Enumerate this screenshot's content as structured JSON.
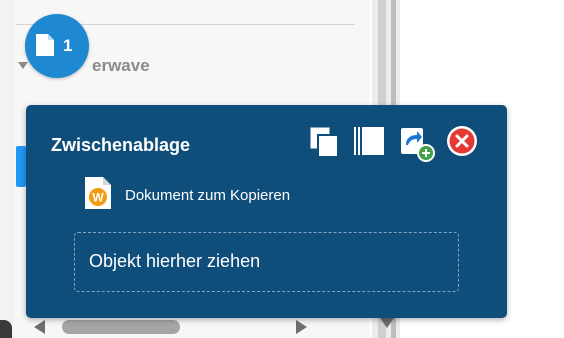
{
  "badge": {
    "count": "1",
    "icon": "document-icon"
  },
  "tree": {
    "label": "erwave"
  },
  "clipboard": {
    "title": "Zwischenablage",
    "tools": {
      "copy": {
        "icon": "copy-icon"
      },
      "columns": {
        "icon": "panel-icon"
      },
      "paste": {
        "icon": "paste-add-icon"
      },
      "close": {
        "icon": "close-icon"
      }
    },
    "items": [
      {
        "label": "Dokument zum Kopieren",
        "icon": "word-document-icon"
      }
    ],
    "dropzone": {
      "label": "Objekt hierher ziehen"
    }
  },
  "colors": {
    "popup": "#0f4e7a",
    "badge": "#1e88d0",
    "close": "#e53935",
    "accent": "#2196f3"
  }
}
